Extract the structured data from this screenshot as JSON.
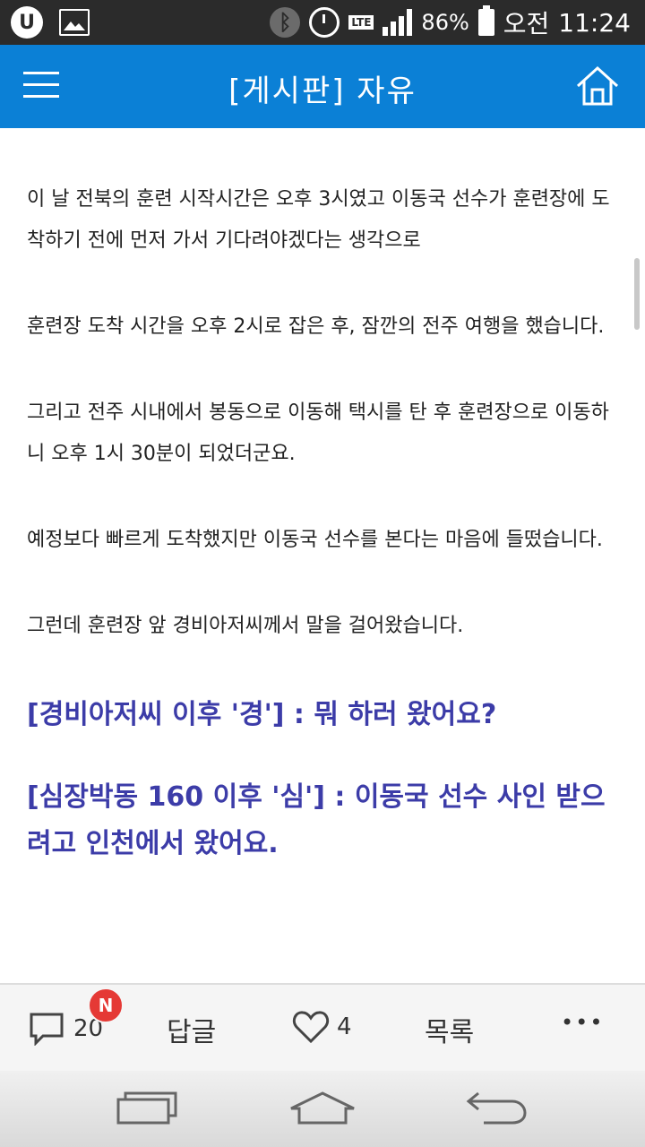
{
  "status_bar": {
    "battery": "86%",
    "time_period": "오전",
    "time": "11:24",
    "network": "LTE",
    "icons": [
      "u-plus-icon",
      "image-icon",
      "bluetooth-icon",
      "alarm-icon",
      "lte-icon",
      "signal-icon",
      "battery-icon"
    ]
  },
  "header": {
    "title": "[게시판] 자유"
  },
  "article": {
    "paragraphs": [
      "이 날 전북의 훈련 시작시간은 오후 3시였고 이동국 선수가 훈련장에 도착하기 전에 먼저 가서 기다려야겠다는 생각으로",
      "훈련장 도착 시간을 오후 2시로 잡은 후, 잠깐의 전주 여행을 했습니다.",
      "그리고 전주 시내에서 봉동으로 이동해 택시를 탄 후 훈련장으로 이동하니 오후 1시 30분이 되었더군요.",
      "예정보다 빠르게 도착했지만 이동국 선수를 본다는 마음에 들떴습니다.",
      "그런데 훈련장 앞 경비아저씨께서 말을 걸어왔습니다."
    ],
    "dialogue": [
      "[경비아저씨 이후 '경'] : 뭐 하러 왔어요?",
      "[심장박동 160 이후 '심'] : 이동국 선수 사인 받으려고 인천에서 왔어요."
    ],
    "colors": {
      "dialogue": "#3c3ca8"
    }
  },
  "toolbar": {
    "comment_count": "20",
    "new_badge": "N",
    "reply_label": "답글",
    "like_count": "4",
    "list_label": "목록",
    "more_label": "•••"
  },
  "colors": {
    "header_bg": "#0b80d6",
    "status_bg": "#2b2b2b",
    "badge": "#e53935"
  }
}
